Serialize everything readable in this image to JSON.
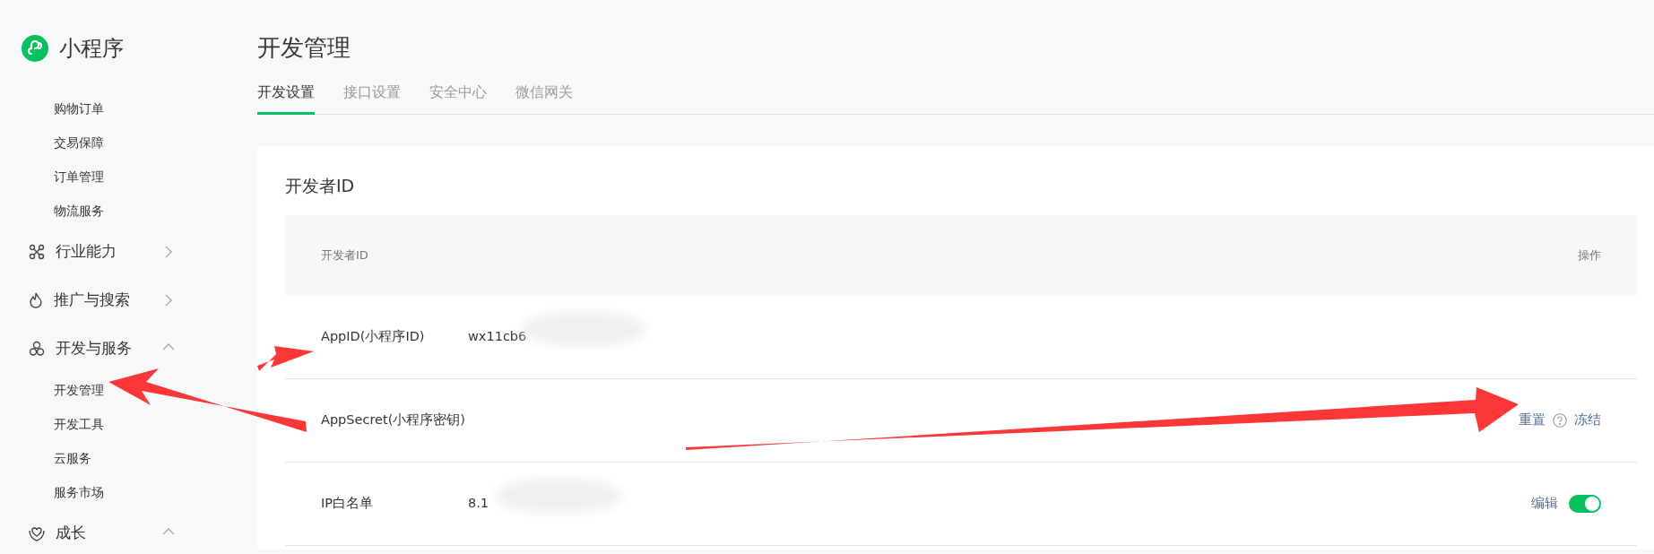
{
  "app": {
    "name": "小程序"
  },
  "sidebar": {
    "items": [
      {
        "kind": "sub",
        "label": "购物订单"
      },
      {
        "kind": "sub",
        "label": "交易保障"
      },
      {
        "kind": "sub",
        "label": "订单管理"
      },
      {
        "kind": "sub",
        "label": "物流服务"
      },
      {
        "kind": "group",
        "label": "行业能力",
        "expanded": false
      },
      {
        "kind": "group",
        "label": "推广与搜索",
        "expanded": false
      },
      {
        "kind": "group",
        "label": "开发与服务",
        "expanded": true,
        "children": [
          {
            "label": "开发管理"
          },
          {
            "label": "开发工具"
          },
          {
            "label": "云服务"
          },
          {
            "label": "服务市场"
          }
        ]
      },
      {
        "kind": "group",
        "label": "成长",
        "expanded": true
      }
    ]
  },
  "page": {
    "title": "开发管理"
  },
  "tabs": [
    {
      "label": "开发设置",
      "selected": true
    },
    {
      "label": "接口设置",
      "selected": false
    },
    {
      "label": "安全中心",
      "selected": false
    },
    {
      "label": "微信网关",
      "selected": false
    }
  ],
  "card": {
    "title": "开发者ID",
    "table": {
      "columns": [
        "开发者ID",
        "操作"
      ],
      "rows": [
        {
          "label": "AppID(小程序ID)",
          "value": "wx11cb6",
          "masked": true,
          "actions": []
        },
        {
          "label": "AppSecret(小程序密钥)",
          "actions": [
            {
              "kind": "link",
              "label": "重置"
            },
            {
              "kind": "help"
            },
            {
              "kind": "link",
              "label": "冻结"
            }
          ]
        },
        {
          "label": "IP白名单",
          "value": "8.1",
          "masked": true,
          "actions": [
            {
              "kind": "link",
              "label": "编辑"
            },
            {
              "kind": "switch",
              "on": true
            }
          ]
        }
      ]
    }
  }
}
